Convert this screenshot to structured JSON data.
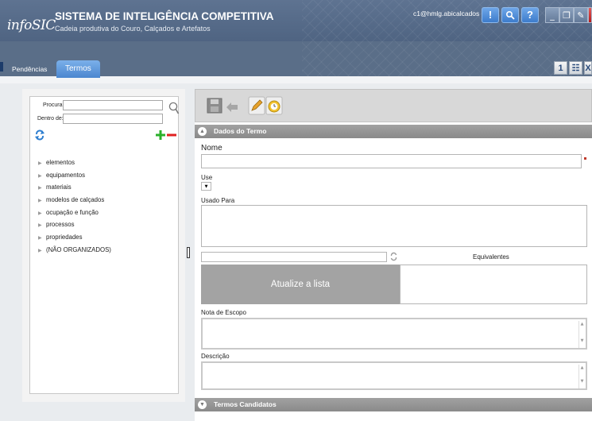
{
  "app": {
    "logo_text": "infoSIC",
    "title": "SISTEMA DE INTELIGÊNCIA COMPETITIVA",
    "subtitle": "Cadeia produtiva do Couro, Calçados e Artefatos",
    "user_email": "c1@hmlg.abicalcados"
  },
  "header_buttons": [
    {
      "icon": "exclamation-icon",
      "glyph": "!"
    },
    {
      "icon": "search-icon",
      "glyph": "🔍"
    },
    {
      "icon": "help-icon",
      "glyph": "?"
    }
  ],
  "window_buttons": [
    {
      "icon": "minimize-icon",
      "glyph": "_"
    },
    {
      "icon": "restore-icon",
      "glyph": "❐"
    },
    {
      "icon": "tools-icon",
      "glyph": "✎"
    },
    {
      "icon": "close-icon",
      "glyph": "⏻"
    }
  ],
  "tabs": [
    {
      "label": "Pendências",
      "active": false
    },
    {
      "label": "Termos",
      "active": true
    }
  ],
  "right_buttons": [
    {
      "icon": "one-window-icon",
      "glyph": "1"
    },
    {
      "icon": "grid-icon",
      "glyph": "☷"
    },
    {
      "icon": "close-all-icon",
      "glyph": "X"
    }
  ],
  "search": {
    "procurar_label": "Procurar:",
    "procurar_value": "",
    "dentro_label": "Dentro de:",
    "dentro_value": ""
  },
  "tree": {
    "items": [
      "elementos",
      "equipamentos",
      "materiais",
      "modelos de calçados",
      "ocupação e função",
      "processos",
      "propriedades",
      "(NÃO ORGANIZADOS)"
    ]
  },
  "term": {
    "section_title": "Dados do Termo",
    "nome_label": "Nome",
    "nome_value": "",
    "use_label": "Use",
    "usado_para_label": "Usado Para",
    "equivalentes_label": "Equivalentes",
    "atualize_label": "Atualize a lista",
    "nota_label": "Nota de Escopo",
    "descricao_label": "Descrição",
    "candidatos_title": "Termos Candidatos"
  },
  "colors": {
    "header": "#5a6e88",
    "tab_active": "#4a86cf",
    "add": "#2bb02b",
    "remove": "#e02020",
    "atualize_bg": "#a3a3a3",
    "required_marker": "#c0392b"
  }
}
